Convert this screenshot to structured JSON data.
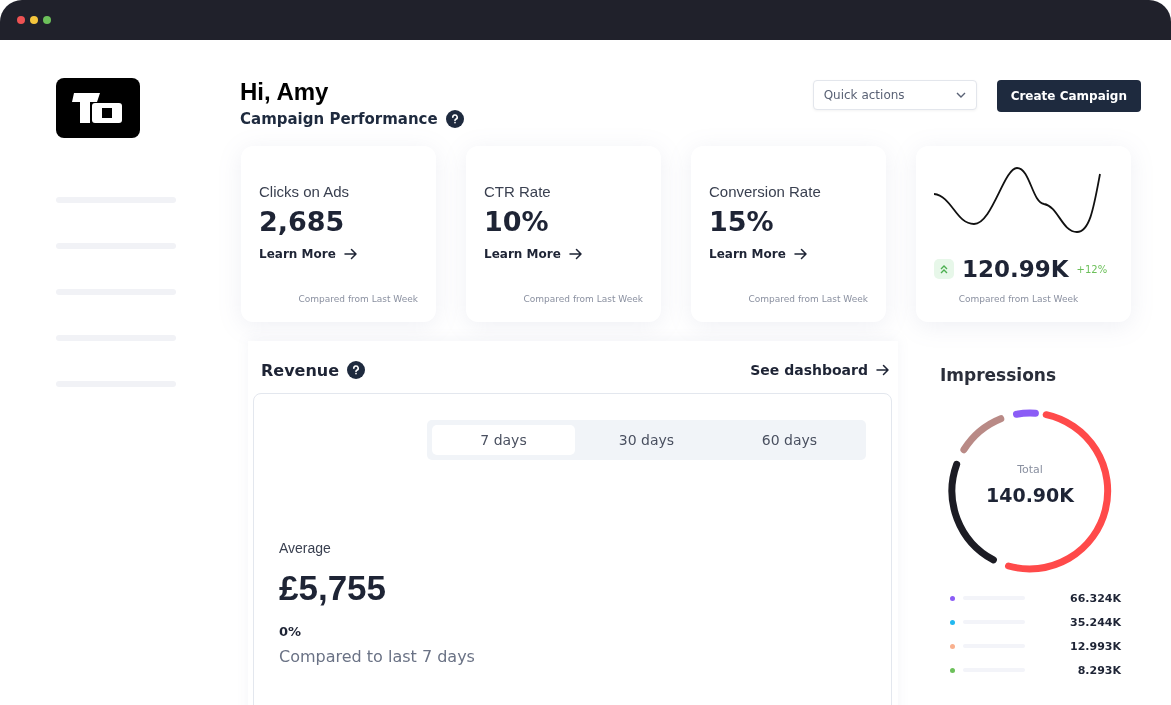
{
  "header": {
    "greeting": "Hi, Amy",
    "subtitle": "Campaign Performance",
    "quick_actions": {
      "placeholder": "Quick actions"
    },
    "primary_button": "Create Campaign"
  },
  "stat_cards": [
    {
      "title": "Clicks on Ads",
      "value": "2,685",
      "link": "Learn More",
      "footnote": "Compared from Last Week"
    },
    {
      "title": "CTR Rate",
      "value": "10%",
      "link": "Learn More",
      "footnote": "Compared from Last Week"
    },
    {
      "title": "Conversion Rate",
      "value": "15%",
      "link": "Learn More",
      "footnote": "Compared from Last Week"
    }
  ],
  "trend_card": {
    "value": "120.99K",
    "change": "+12%",
    "footnote": "Compared from Last Week"
  },
  "revenue": {
    "title": "Revenue",
    "link": "See dashboard",
    "tabs": [
      {
        "label": "7 days",
        "selected": true
      },
      {
        "label": "30 days",
        "selected": false
      },
      {
        "label": "60 days",
        "selected": false
      }
    ],
    "average_label": "Average",
    "average_value": "£5,755",
    "change": "0%",
    "comparison": "Compared to last 7 days"
  },
  "impressions": {
    "title": "Impressions",
    "total_label": "Total",
    "total_value": "140.90K",
    "legend": [
      {
        "color": "#8b5cf6",
        "value": "66.324K"
      },
      {
        "color": "#22b8f0",
        "value": "35.244K"
      },
      {
        "color": "#f9b08e",
        "value": "12.993K"
      },
      {
        "color": "#6cc05a",
        "value": "8.293K"
      }
    ]
  }
}
